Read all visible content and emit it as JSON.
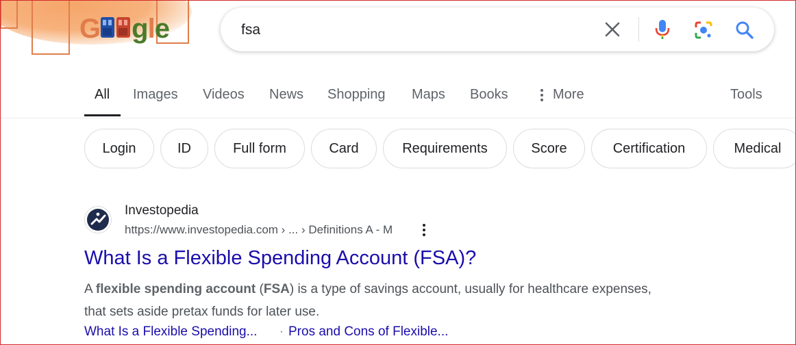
{
  "doodle": {
    "logo_letters": [
      "G",
      "oo",
      "g",
      "l",
      "e"
    ],
    "colors": {
      "blue": "#4285f4",
      "red": "#ea4335",
      "yellow": "#fbbc05",
      "green": "#34a853",
      "orange": "#e07d4a"
    }
  },
  "search": {
    "query": "fsa",
    "icons": [
      "close-icon",
      "mic-icon",
      "lens-icon",
      "search-icon"
    ]
  },
  "tabs": [
    {
      "label": "All",
      "active": true
    },
    {
      "label": "Images"
    },
    {
      "label": "Videos"
    },
    {
      "label": "News"
    },
    {
      "label": "Shopping"
    },
    {
      "label": "Maps"
    },
    {
      "label": "Books"
    },
    {
      "label": "More"
    }
  ],
  "tools_label": "Tools",
  "chips": [
    "Login",
    "ID",
    "Full form",
    "Card",
    "Requirements",
    "Score",
    "Certification",
    "Medical"
  ],
  "result": {
    "site_name": "Investopedia",
    "url": "https://www.investopedia.com › ... › Definitions A - M",
    "title": "What Is a Flexible Spending Account (FSA)?",
    "snippet": {
      "pre": "A ",
      "bold1": "flexible spending account",
      "mid1": " (",
      "bold2": "FSA",
      "post": ") is a type of savings account, usually for healthcare expenses, that sets aside pretax funds for later use."
    },
    "sublinks": [
      "What Is a Flexible Spending...",
      "Pros and Cons of Flexible..."
    ],
    "sublink_sep": "·"
  },
  "colors": {
    "link": "#1a0dab",
    "text": "#202124",
    "muted": "#5f6368"
  }
}
